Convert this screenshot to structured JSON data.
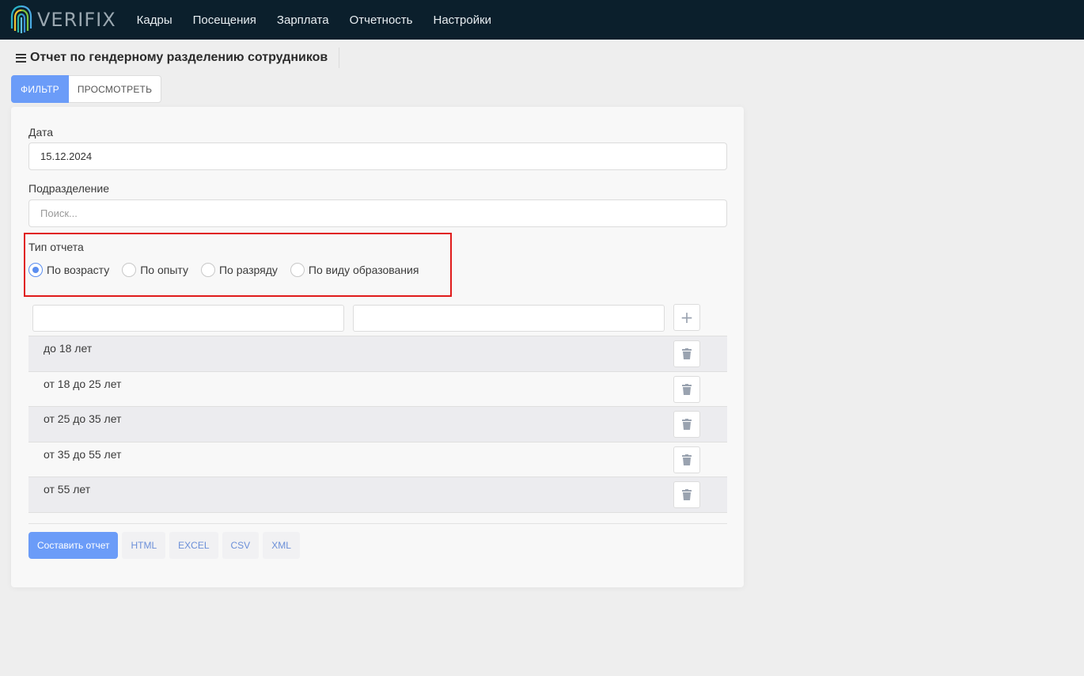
{
  "brand": {
    "name": "VERIFIX"
  },
  "nav": {
    "items": [
      {
        "label": "Кадры"
      },
      {
        "label": "Посещения"
      },
      {
        "label": "Зарплата"
      },
      {
        "label": "Отчетность"
      },
      {
        "label": "Настройки"
      }
    ]
  },
  "page": {
    "title": "Отчет по гендерному разделению сотрудников"
  },
  "tabs": [
    {
      "label": "ФИЛЬТР",
      "active": true
    },
    {
      "label": "ПРОСМОТРЕТЬ",
      "active": false
    }
  ],
  "form": {
    "date": {
      "label": "Дата",
      "value": "15.12.2024"
    },
    "division": {
      "label": "Подразделение",
      "placeholder": "Поиск..."
    },
    "report_type": {
      "label": "Тип отчета",
      "options": [
        {
          "label": "По возрасту",
          "checked": true
        },
        {
          "label": "По опыту",
          "checked": false
        },
        {
          "label": "По разряду",
          "checked": false
        },
        {
          "label": "По виду образования",
          "checked": false
        }
      ]
    },
    "ranges": {
      "from_value": "",
      "to_value": "",
      "add_icon": "plus-icon",
      "delete_icon": "trash-icon",
      "rows": [
        {
          "label": "до 18 лет"
        },
        {
          "label": "от 18 до 25 лет"
        },
        {
          "label": "от 25 до 35 лет"
        },
        {
          "label": "от 35 до 55 лет"
        },
        {
          "label": "от 55 лет"
        }
      ]
    }
  },
  "actions": {
    "build": "Составить отчет",
    "formats": [
      "HTML",
      "EXCEL",
      "CSV",
      "XML"
    ]
  },
  "colors": {
    "nav_bg": "#0b1f2c",
    "accent": "#6b9cf8",
    "highlight": "#e01b1b"
  }
}
